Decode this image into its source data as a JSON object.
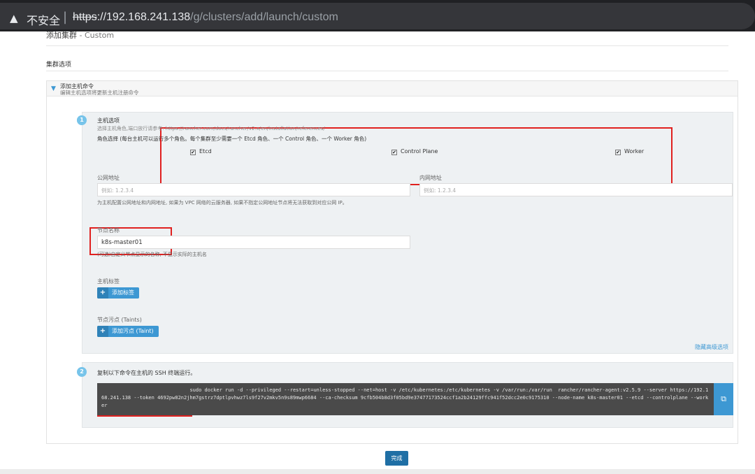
{
  "browser": {
    "warning_icon": "warning-triangle-icon",
    "warning_glyph": "▲",
    "insecure_label": "不安全",
    "separator": "|",
    "url_scheme": "https",
    "url_host": "://192.168.241.138",
    "url_path": "/g/clusters/add/launch/custom"
  },
  "page": {
    "title": "添加集群",
    "title_suffix": " - Custom",
    "section_title": "集群选项"
  },
  "command_section": {
    "toggle_glyph": "▼",
    "title": "添加主机命令",
    "subtitle": "编辑主机选项将更新主机注册命令"
  },
  "step1": {
    "number": "1",
    "title": "主机选项",
    "help": "选择主机角色,端口放行请参考: https://rancher.com/docs/rancher/v2.x/en/installation/references/",
    "roles_label": "角色选择 (每台主机可以运行多个角色。每个集群至少需要一个 Etcd 角色、一个 Control 角色、一个 Worker 角色)",
    "roles": [
      {
        "label": "Etcd",
        "checked": "✔"
      },
      {
        "label": "Control Plane",
        "checked": "✔"
      },
      {
        "label": "Worker",
        "checked": "✔"
      }
    ],
    "public_addr_label": "公网地址",
    "public_addr_placeholder": "例如: 1.2.3.4",
    "internal_addr_label": "内网地址",
    "internal_addr_placeholder": "例如: 1.2.3.4",
    "addr_help": "为主机配置公网地址和内网地址, 如果为 VPC 网络的云服务器, 如果不指定公网地址节点将无法获取到对应公网 IP。",
    "node_name_label": "节点名称",
    "node_name_value": "k8s-master01",
    "node_name_help": "(可选)自定义节点显示的名称, 不显示实际的主机名",
    "labels_label": "主机标签",
    "add_label_button": "添加标签",
    "taints_label": "节点污点 (Taints)",
    "add_taint_button": "添加污点 (Taint)",
    "plus_glyph": "+",
    "hide_advanced": "隐藏高级选项"
  },
  "step2": {
    "number": "2",
    "title": "复制以下命令在主机的 SSH 终端运行。",
    "command": "                              sudo docker run -d --privileged --restart=unless-stopped --net=host -v /etc/kubernetes:/etc/kubernetes -v /var/run:/var/run  rancher/rancher-agent:v2.5.9 --server https://192.168.241.138 --token 4692pw82n2jhm7gstrz7dptlpvhwz7ls9f27v2mkv5n9s89mwp6684 --ca-checksum 9cfb504b8d3f05bd9e37477173524ccf1a2b24129ffc941f52dcc2e0c9175310 --node-name k8s-master01 --etcd --controlplane --worker",
    "copy_glyph": "⧉"
  },
  "footer": {
    "done_button": "完成"
  }
}
